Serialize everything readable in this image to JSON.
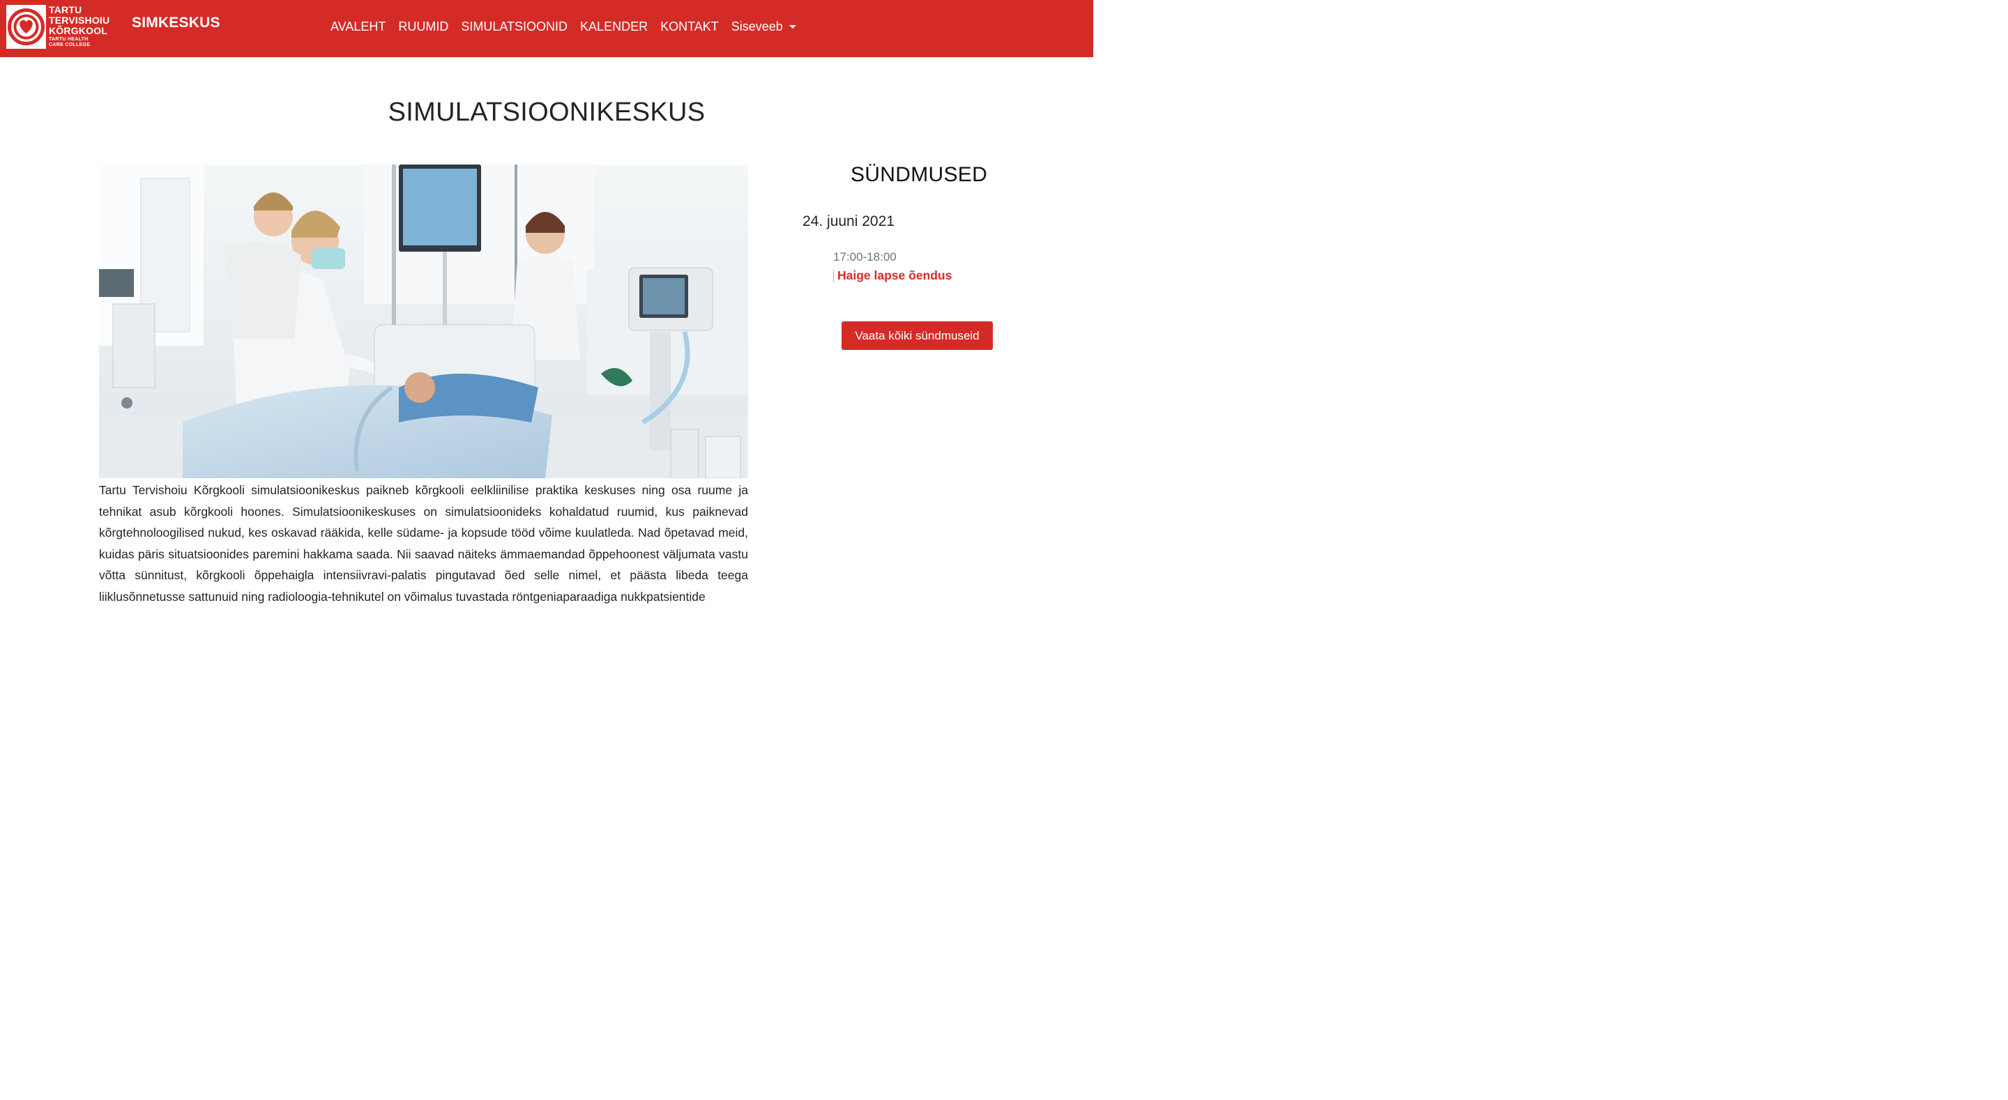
{
  "header": {
    "logo": {
      "line1": "TARTU",
      "line2": "TERVISHOIU",
      "line3": "KÕRGKOOL",
      "line4": "TARTU HEALTH",
      "line5": "CARE COLLEGE",
      "icon": "heart-spiral-logo"
    },
    "brand": "SIMKESKUS",
    "nav": [
      {
        "label": "AVALEHT"
      },
      {
        "label": "RUUMID"
      },
      {
        "label": "SIMULATSIOONID"
      },
      {
        "label": "KALENDER"
      },
      {
        "label": "KONTAKT"
      },
      {
        "label": "Siseveeb",
        "icon": "caret-down-icon"
      }
    ],
    "color": "#d52b27"
  },
  "main": {
    "title": "SIMULATSIOONIKESKUS",
    "intro": "Tartu Tervishoiu Kõrgkooli simulatsioonikeskus paikneb kõrgkooli eelkliinilise praktika keskuses ning osa ruume ja tehnikat asub kõrgkooli hoones. Simulatsioonikeskuses on simulatsioonideks kohaldatud ruumid, kus paiknevad kõrgtehnoloogilised nukud, kes oskavad rääkida, kelle südame- ja kopsude tööd võime kuulatleda. Nad õpetavad meid, kuidas päris situatsioonides paremini hakkama saada. Nii saavad näiteks ämmaemandad õppehoonest väljumata vastu võtta sünnitust, kõrgkooli õppehaigla intensiivravi-palatis pingutavad õed selle nimel, et päästa libeda teega liiklusõnnetusse sattunuid ning radioloogia-tehnikutel on võimalus tuvastada röntgeniaparaadiga nukkpatsientide"
  },
  "sidebar": {
    "title": "SÜNDMUSED",
    "events": [
      {
        "date": "24. juuni 2021",
        "time": "17:00-18:00",
        "name": "Haige lapse õendus"
      }
    ],
    "all_button": "Vaata kõiki sündmuseid",
    "accent": "#d52b27"
  }
}
